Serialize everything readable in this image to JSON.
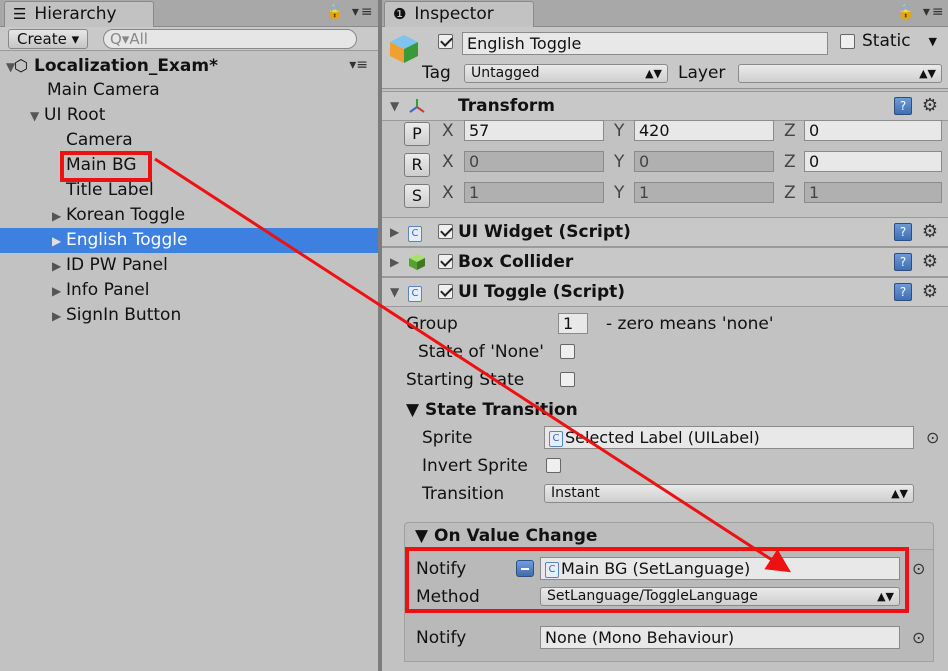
{
  "hierarchy": {
    "tab_title": "Hierarchy",
    "tab_icon": "☰",
    "tools": "🔒 ▾≡",
    "create_label": "Create ▾",
    "search_placeholder": "Q▾All",
    "scene": "Localization_Exam*",
    "items": [
      {
        "label": "Main Camera",
        "indent": 1,
        "arrow": ""
      },
      {
        "label": "UI Root",
        "indent": 1,
        "arrow": "▼"
      },
      {
        "label": "Camera",
        "indent": 2,
        "arrow": ""
      },
      {
        "label": "Main BG",
        "indent": 2,
        "arrow": ""
      },
      {
        "label": "Title Label",
        "indent": 2,
        "arrow": ""
      },
      {
        "label": "Korean Toggle",
        "indent": 2,
        "arrow": "▶"
      },
      {
        "label": "English Toggle",
        "indent": 2,
        "arrow": "▶",
        "selected": true
      },
      {
        "label": "ID PW Panel",
        "indent": 2,
        "arrow": "▶"
      },
      {
        "label": "Info Panel",
        "indent": 2,
        "arrow": "▶"
      },
      {
        "label": "SignIn Button",
        "indent": 2,
        "arrow": "▶"
      }
    ]
  },
  "inspector": {
    "tab_title": "Inspector",
    "tab_icon": "❶",
    "tools": "🔒 ▾≡",
    "object_name": "English Toggle",
    "static_label": "Static",
    "tag_label": "Tag",
    "tag_value": "Untagged",
    "layer_label": "Layer",
    "layer_value": "",
    "transform": {
      "title": "Transform",
      "position": {
        "btn": "P",
        "x": "57",
        "y": "420",
        "z": "0"
      },
      "rotation": {
        "btn": "R",
        "x": "0",
        "y": "0",
        "z": "0"
      },
      "scale": {
        "btn": "S",
        "x": "1",
        "y": "1",
        "z": "1"
      },
      "x_label": "X",
      "y_label": "Y",
      "z_label": "Z"
    },
    "components": {
      "widget": "UI Widget (Script)",
      "collider": "Box Collider",
      "toggle": "UI Toggle (Script)"
    },
    "toggle": {
      "group_label": "Group",
      "group_value": "1",
      "group_hint": "- zero means 'none'",
      "state_none_label": "State of 'None'",
      "starting_state_label": "Starting State",
      "state_transition_label": "▼ State Transition",
      "sprite_label": "Sprite",
      "sprite_value": "Selected Label (UILabel)",
      "invert_label": "Invert Sprite",
      "transition_label": "Transition",
      "transition_value": "Instant",
      "on_value_change_label": "▼ On Value Change",
      "notify_label": "Notify",
      "notify_value": "Main BG (SetLanguage)",
      "method_label": "Method",
      "method_value": "SetLanguage/ToggleLanguage",
      "notify2_label": "Notify",
      "notify2_value": "None (Mono Behaviour)"
    }
  },
  "colors": {
    "selection": "#3d80df",
    "annotation": "#e11111",
    "panel_bg": "#c2c2c2"
  }
}
